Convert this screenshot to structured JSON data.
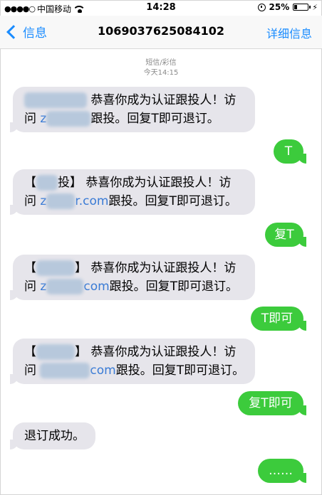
{
  "status_bar": {
    "carrier": "中国移动",
    "signal_dots": "●●●●○",
    "time": "14:28",
    "battery": "25%",
    "battery_fraction": 0.25
  },
  "nav": {
    "back_label": "信息",
    "title": "1069037625084102",
    "details_label": "详细信息"
  },
  "meta": {
    "type": "短信/彩信",
    "timestamp": "今天14:15"
  },
  "messages": [
    {
      "direction": "incoming",
      "line1_prefix": "",
      "line1_text": "恭喜你成为认证跟投人！访",
      "line2_prefix": "问",
      "line2_link": "z",
      "line2_link_tail": "",
      "line2_text": "跟投。回复T即可退订。"
    },
    {
      "direction": "outgoing",
      "text": "T"
    },
    {
      "direction": "incoming",
      "line1_prefix": "【",
      "line1_mid": "投】",
      "line1_text": "恭喜你成为认证跟投人！访",
      "line2_prefix": "问",
      "line2_link": "z",
      "line2_link_tail": "r.com",
      "line2_text": "跟投。回复T即可退订。"
    },
    {
      "direction": "outgoing",
      "text": "复T"
    },
    {
      "direction": "incoming",
      "line1_prefix": "【",
      "line1_mid": "】",
      "line1_text": "恭喜你成为认证跟投人！访",
      "line2_prefix": "问",
      "line2_link": "z",
      "line2_link_tail": "com",
      "line2_text": "跟投。回复T即可退订。"
    },
    {
      "direction": "outgoing",
      "text": "T即可"
    },
    {
      "direction": "incoming",
      "line1_prefix": "【",
      "line1_mid": "】",
      "line1_text": "恭喜你成为认证跟投人！访",
      "line2_prefix": "问",
      "line2_link": "",
      "line2_link_tail": "com",
      "line2_text": "跟投。回复T即可退订。"
    },
    {
      "direction": "outgoing",
      "text": "复T即可"
    },
    {
      "direction": "incoming",
      "text": "退订成功。"
    },
    {
      "direction": "outgoing",
      "text": "……"
    }
  ],
  "colors": {
    "ios_blue": "#1a8cff",
    "outgoing_green": "#3ccb3c",
    "incoming_gray": "#e6e5eb",
    "link_blue": "#3a7bd5"
  }
}
